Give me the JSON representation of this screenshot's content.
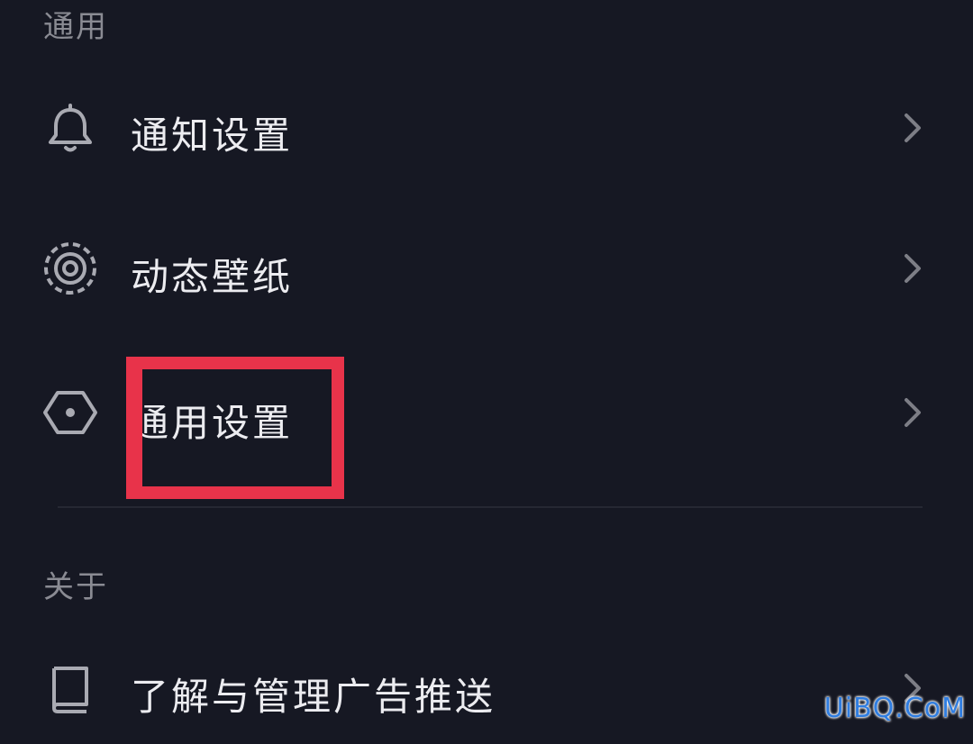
{
  "sections": {
    "general": {
      "title": "通用",
      "items": [
        {
          "label": "通知设置",
          "icon": "bell-icon"
        },
        {
          "label": "动态壁纸",
          "icon": "live-wallpaper-icon"
        },
        {
          "label": "通用设置",
          "icon": "hexagon-settings-icon"
        }
      ]
    },
    "about": {
      "title": "关于",
      "items": [
        {
          "label": "了解与管理广告推送",
          "icon": "book-icon"
        }
      ]
    }
  },
  "highlight_color": "#e8334a",
  "watermark": "UiBQ.CoM",
  "colors": {
    "background": "#161823",
    "section_title": "#8a8b93",
    "label": "#ececf0",
    "icon": "#a9aab2",
    "chevron": "#7d7e86"
  }
}
